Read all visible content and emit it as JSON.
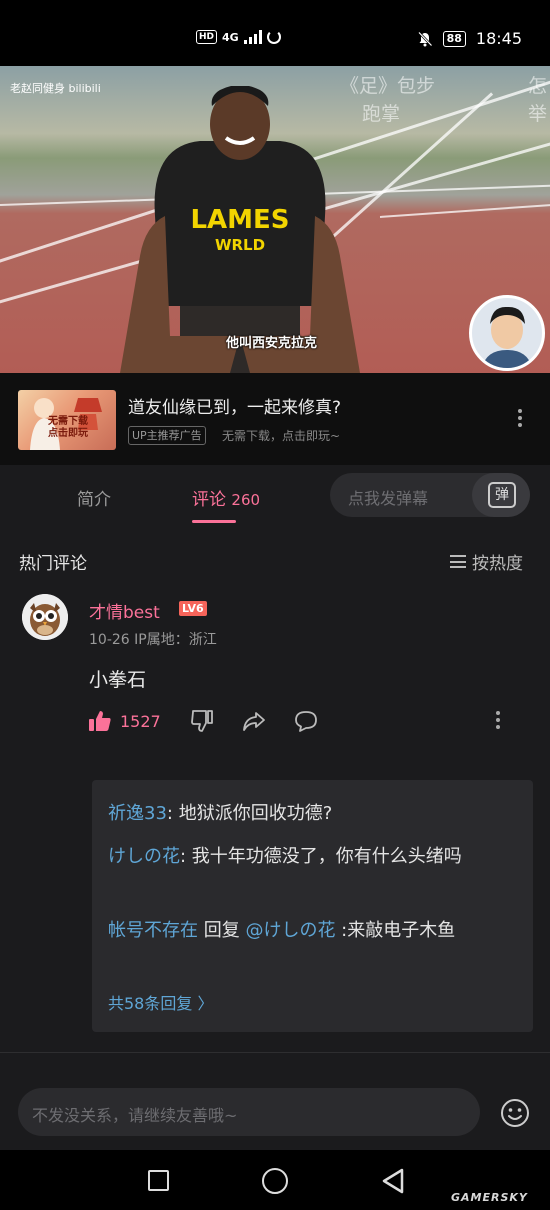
{
  "status_bar": {
    "network_label": "HD",
    "network_type": "4G",
    "battery": "88",
    "time": "18:45"
  },
  "video": {
    "watermark_left": "老赵同健身 bilibili",
    "watermark_right": "《足》包步",
    "watermark_right_line2": "跑掌",
    "watermark_edge": "怎",
    "watermark_edge_line2": "举",
    "shirt_text_1": "LAMES",
    "shirt_text_2": "WRLD",
    "subtitle": "他叫西安克拉克"
  },
  "ad": {
    "thumb_text_1": "无需下载",
    "thumb_text_2": "点击即玩",
    "title": "道友仙缘已到，一起来修真?",
    "tag": "UP主推荐广告",
    "subtitle": "无需下载，点击即玩~"
  },
  "tabs": {
    "intro": "简介",
    "comments": "评论",
    "comments_count": "260",
    "danmaku_placeholder": "点我发弹幕",
    "danmaku_icon_text": "弹"
  },
  "comments": {
    "section_title": "热门评论",
    "sort_label": "按热度",
    "top": {
      "username": "才情best",
      "level": "LV6",
      "meta": "10-26  IP属地：浙江",
      "text": "小拳石",
      "likes": "1527"
    },
    "replies": [
      {
        "user": "祈逸33",
        "text": ": 地狱派你回收功德?"
      },
      {
        "user": "けしの花",
        "text": ": 我十年功德没了，你有什么头绪吗"
      },
      {
        "user": "帐号不存在",
        "mid": " 回复 ",
        "mention": "@けしの花",
        "text": " :来敲电子木鱼"
      }
    ],
    "more_replies": "共58条回复 〉"
  },
  "input": {
    "placeholder": "不发没关系，请继续友善哦~"
  },
  "watermark": "GAMERSKY",
  "colors": {
    "accent": "#fb7299",
    "link": "#5fa6d6",
    "background": "#1b1b1d"
  },
  "icons": [
    "bell-off-icon",
    "battery-icon",
    "more-vertical-icon",
    "danmaku-icon",
    "sort-icon",
    "like-icon",
    "dislike-icon",
    "share-icon",
    "reply-icon",
    "emoji-icon",
    "nav-recent-icon",
    "nav-home-icon",
    "nav-back-icon"
  ]
}
